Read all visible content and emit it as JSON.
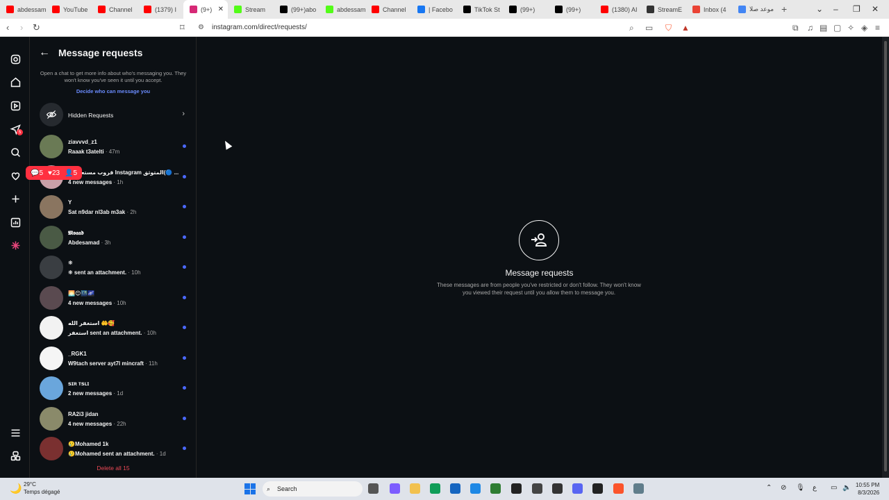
{
  "browser": {
    "tabs": [
      {
        "title": "abdessam",
        "icon": "youtube-icon",
        "color": "#ff0000"
      },
      {
        "title": "YouTube",
        "icon": "youtube-icon",
        "color": "#ff0000"
      },
      {
        "title": "Channel",
        "icon": "youtube-icon",
        "color": "#ff0000"
      },
      {
        "title": "(1379) I",
        "icon": "youtube-icon",
        "color": "#ff0000"
      },
      {
        "title": "(9+)",
        "icon": "instagram-icon",
        "color": "#d62976",
        "active": true
      },
      {
        "title": "Stream",
        "icon": "kick-icon",
        "color": "#53fc18"
      },
      {
        "title": "(99+)abo",
        "icon": "tiktok-icon",
        "color": "#000000"
      },
      {
        "title": "abdessam",
        "icon": "kick-icon",
        "color": "#53fc18"
      },
      {
        "title": "Channel",
        "icon": "youtube-icon",
        "color": "#ff0000"
      },
      {
        "title": "| Facebo",
        "icon": "facebook-icon",
        "color": "#1877f2"
      },
      {
        "title": "TikTok St",
        "icon": "tiktok-icon",
        "color": "#000000"
      },
      {
        "title": "(99+)",
        "icon": "tiktok-icon",
        "color": "#000000"
      },
      {
        "title": "(99+)",
        "icon": "tiktok-icon",
        "color": "#000000"
      },
      {
        "title": "(1380) AI",
        "icon": "youtube-icon",
        "color": "#ff0000"
      },
      {
        "title": "StreamE",
        "icon": "download-icon",
        "color": "#333333"
      },
      {
        "title": "Inbox (4",
        "icon": "gmail-icon",
        "color": "#ea4335"
      },
      {
        "title": "موعد صلا",
        "icon": "google-icon",
        "color": "#4285f4"
      }
    ],
    "url": "instagram.com/direct/requests/"
  },
  "rail": {
    "notification": {
      "comments": "5",
      "likes": "23",
      "follows": "5"
    }
  },
  "panel": {
    "title": "Message requests",
    "intro": "Open a chat to get more info about who's messaging you. They won't know you've seen it until you accept.",
    "decide_link": "Decide who can message you",
    "hidden_label": "Hidden Requests",
    "requests": [
      {
        "name": "ziavvvd_z1",
        "preview": "Raaak t3atelti",
        "time": " · 47m",
        "avatar": "#6a7a55"
      },
      {
        "name": "قروب مستعملين Instagram المتوثق(🔵 ...",
        "preview": "4 new messages",
        "time": " · 1h",
        "avatar": "#caa0a8"
      },
      {
        "name": "Y",
        "preview": "Sat n9dar nl3ab m3ak",
        "time": " · 2h",
        "avatar": "#8a7560"
      },
      {
        "name": "𝕸𝖔𝖆𝖆𝖉",
        "preview": "Abdesamad",
        "time": " · 3h",
        "avatar": "#4a5a45"
      },
      {
        "name": "❋",
        "preview": "❋ sent an attachment.",
        "time": " · 10h",
        "avatar": "#3a3e42"
      },
      {
        "name": "🌅😊🌃🌌",
        "preview": "4 new messages",
        "time": " · 10h",
        "avatar": "#5a4a50"
      },
      {
        "name": "استغفر الله 🤲🥰",
        "preview": "استغفر sent an attachment.",
        "time": " · 10h",
        "avatar": "#f2f2f2"
      },
      {
        "name": "_RGK1",
        "preview": "W9tach server ayt7l mincraft",
        "time": " · 11h",
        "avatar": "#f5f5f5"
      },
      {
        "name": "ꜱɪʀ ᴛꜱʟɪ",
        "preview": "2 new messages",
        "time": " · 1d",
        "avatar": "#6aa6dc"
      },
      {
        "name": "RA2i3 jidan",
        "preview": "4 new messages",
        "time": " · 22h",
        "avatar": "#8a8a6a"
      },
      {
        "name": "🥲Mohamed 1k",
        "preview": "🥲Mohamed sent an attachment.",
        "time": " · 1d",
        "avatar": "#7a3030"
      }
    ],
    "delete_all": "Delete all 15"
  },
  "main": {
    "title": "Message requests",
    "description": "These messages are from people you've restricted or don't follow. They won't know you viewed their request until you allow them to message you."
  },
  "taskbar": {
    "temp": "29°C",
    "weather": "Temps dégagé",
    "search_placeholder": "Search",
    "time": "10:55 PM",
    "date": "8/3/2026"
  }
}
